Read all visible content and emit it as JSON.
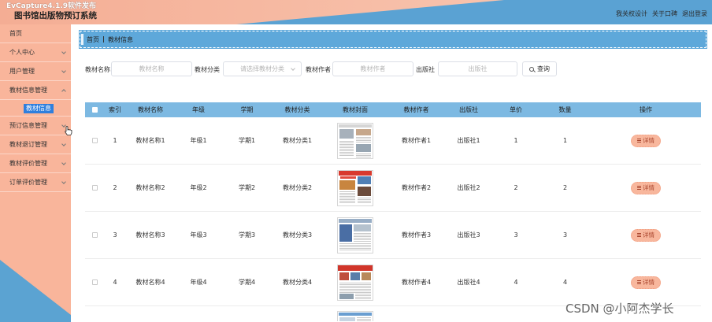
{
  "window": {
    "capture_overlay": "EvCapture4.1.9软件发布",
    "title": "图书馆出版物预订系统",
    "header_links": [
      "我关权设计",
      "关于口碑"
    ],
    "logout_label": "退出登录"
  },
  "sidebar": {
    "items": [
      {
        "label": "首页"
      },
      {
        "label": "个人中心",
        "icon": "chevron-down-icon"
      },
      {
        "label": "用户管理",
        "icon": "chevron-down-icon"
      },
      {
        "label": "教材信息管理",
        "icon": "chevron-up-icon",
        "expanded": true,
        "children": [
          {
            "label": "教材信息",
            "active": true
          }
        ]
      },
      {
        "label": "预订信息管理",
        "icon": "chevron-down-icon"
      },
      {
        "label": "教材退订管理",
        "icon": "chevron-down-icon"
      },
      {
        "label": "教材评价管理",
        "icon": "chevron-down-icon"
      },
      {
        "label": "订单评价管理",
        "icon": "chevron-down-icon"
      }
    ]
  },
  "breadcrumb": {
    "home": "首页",
    "current": "教材信息"
  },
  "search": {
    "fields": [
      {
        "label": "教材名称",
        "placeholder": "教材名称",
        "type": "input"
      },
      {
        "label": "教材分类",
        "placeholder": "请选择教材分类",
        "type": "select"
      },
      {
        "label": "教材作者",
        "placeholder": "教材作者",
        "type": "input"
      },
      {
        "label": "出版社",
        "placeholder": "出版社",
        "type": "input"
      }
    ],
    "query_label": "查询",
    "query_icon": "search-icon"
  },
  "table": {
    "columns": [
      "索引",
      "教材名称",
      "年级",
      "学期",
      "教材分类",
      "教材封面",
      "教材作者",
      "出版社",
      "单价",
      "数量",
      "操作"
    ],
    "action_icon": "document-icon",
    "rows": [
      {
        "index": "1",
        "name": "教材名称1",
        "grade": "年级1",
        "term": "学期1",
        "category": "教材分类1",
        "cover": "newspaper-cover-thumbnail",
        "author": "教材作者1",
        "publisher": "出版社1",
        "price": "1",
        "quantity": "1",
        "action": "详情"
      },
      {
        "index": "2",
        "name": "教材名称2",
        "grade": "年级2",
        "term": "学期2",
        "category": "教材分类2",
        "cover": "newspaper-cover-thumbnail",
        "author": "教材作者2",
        "publisher": "出版社2",
        "price": "2",
        "quantity": "2",
        "action": "详情"
      },
      {
        "index": "3",
        "name": "教材名称3",
        "grade": "年级3",
        "term": "学期3",
        "category": "教材分类3",
        "cover": "newspaper-cover-thumbnail",
        "author": "教材作者3",
        "publisher": "出版社3",
        "price": "3",
        "quantity": "3",
        "action": "详情"
      },
      {
        "index": "4",
        "name": "教材名称4",
        "grade": "年级4",
        "term": "学期4",
        "category": "教材分类4",
        "cover": "newspaper-cover-thumbnail",
        "author": "教材作者4",
        "publisher": "出版社4",
        "price": "4",
        "quantity": "4",
        "action": "详情"
      },
      {
        "cover": "newspaper-cover-thumbnail"
      }
    ]
  },
  "watermark": "CSDN @小阿杰学长",
  "colors": {
    "header_blue": "#5aa2d3",
    "header_salmon": "#f4ad94",
    "sidebar_salmon": "#f9b59b",
    "sidebar_blue": "#5ba3d2",
    "breadcrumb_blue": "#5ea8da",
    "table_header_blue": "#7db9e2",
    "active_menu_blue": "#2f7fdd",
    "detail_button": "#f8b79d",
    "detail_text": "#a8432b"
  }
}
